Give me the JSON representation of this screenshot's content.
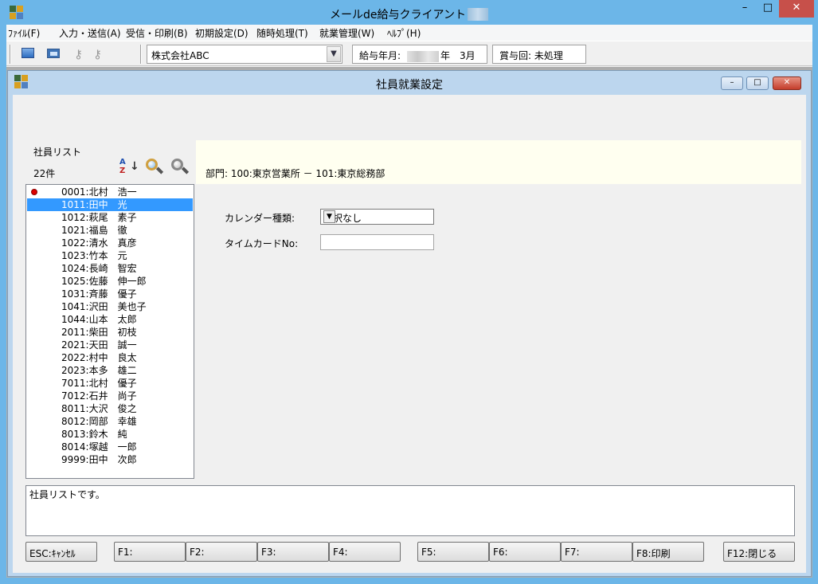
{
  "window": {
    "title": "メールde給与クライアント",
    "min_glyph": "–",
    "max_glyph": "□",
    "close_glyph": "✕"
  },
  "menu": [
    {
      "label": "ﾌｧｲﾙ(F)"
    },
    {
      "label": "入力・送信(A)"
    },
    {
      "label": "受信・印刷(B)"
    },
    {
      "label": "初期設定(D)"
    },
    {
      "label": "随時処理(T)"
    },
    {
      "label": "就業管理(W)"
    },
    {
      "label": "ﾍﾙﾌﾟ(H)"
    }
  ],
  "toolbar": {
    "icons": [
      "monitor-icon",
      "window-icon",
      "key-icon",
      "key-icon"
    ],
    "company": "株式会社ABC",
    "pay_label": "給与年月:",
    "pay_year_suffix": "年",
    "pay_month": "3月",
    "bonus": "賞与回: 未処理",
    "dropdown_glyph": "▼"
  },
  "child": {
    "title": "社員就業設定",
    "min_glyph": "–",
    "max_glyph": "□",
    "close_glyph": "✕"
  },
  "employee_panel": {
    "title": "社員リスト",
    "count": "22件",
    "sort_icon_a": "A",
    "sort_icon_z": "Z",
    "sort_icon_arrow": "↓",
    "employees": [
      {
        "text": "0001:北村　浩一",
        "marker": true
      },
      {
        "text": "1011:田中　光",
        "selected": true
      },
      {
        "text": "1012:萩尾　素子"
      },
      {
        "text": "1021:福島　徹"
      },
      {
        "text": "1022:清水　真彦"
      },
      {
        "text": "1023:竹本　元"
      },
      {
        "text": "1024:長崎　智宏"
      },
      {
        "text": "1025:佐藤　伸一郎"
      },
      {
        "text": "1031:斉藤　優子"
      },
      {
        "text": "1041:沢田　美也子"
      },
      {
        "text": "1044:山本　太郎"
      },
      {
        "text": "2011:柴田　初枝"
      },
      {
        "text": "2021:天田　誠一"
      },
      {
        "text": "2022:村中　良太"
      },
      {
        "text": "2023:本多　雄二"
      },
      {
        "text": "7011:北村　優子"
      },
      {
        "text": "7012:石井　尚子"
      },
      {
        "text": "8011:大沢　俊之"
      },
      {
        "text": "8012:岡部　幸雄"
      },
      {
        "text": "8013:鈴木　純"
      },
      {
        "text": "8014:塚越　一郎"
      },
      {
        "text": "9999:田中　次郎"
      }
    ]
  },
  "detail": {
    "department": "部門:  100:東京営業所 － 101:東京総務部",
    "calendar_label": "カレンダー種類:",
    "calendar_value": "選択なし",
    "timecard_label": "タイムカードNo:",
    "timecard_value": "",
    "dropdown_glyph": "▼"
  },
  "message": "社員リストです。",
  "fkeys": [
    {
      "label": "ESC:ｷｬﾝｾﾙ"
    },
    {
      "label": "F1:"
    },
    {
      "label": "F2:"
    },
    {
      "label": "F3:"
    },
    {
      "label": "F4:"
    },
    {
      "label": "F5:"
    },
    {
      "label": "F6:"
    },
    {
      "label": "F7:"
    },
    {
      "label": "F8:印刷"
    },
    {
      "label": "F12:閉じる"
    }
  ],
  "colors": {
    "title_bar": "#6cb6e8",
    "selection": "#3399ff",
    "dept_bar": "#fffff0",
    "close_button": "#c7504a"
  }
}
